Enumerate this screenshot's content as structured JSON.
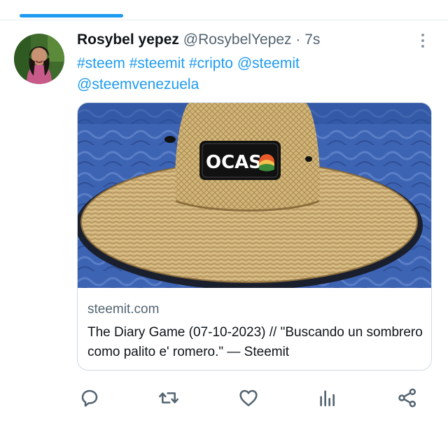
{
  "tweet": {
    "author_name": "Rosybel yepez",
    "handle": "@RosybelYepez",
    "separator": "·",
    "timestamp": "7s",
    "text_line1": "#steem #steemit #cripto @steemit",
    "text_line2": "@steemvenezuela",
    "hashtags": [
      "#steem",
      "#steemit",
      "#cripto"
    ],
    "mentions": [
      "@steemit",
      "@steemvenezuela"
    ]
  },
  "card": {
    "domain": "steemit.com",
    "title": "The Diary Game (07-10-2023) // \"Buscando un sombrero como palito e' romero.\" — Steemit",
    "image_logo_text": "OCASO"
  },
  "actions": [
    "reply-icon",
    "retweet-icon",
    "like-icon",
    "views-icon",
    "share-icon"
  ],
  "colors": {
    "accent": "#1d9bf0",
    "secondary_text": "#536471",
    "icon": "#536471",
    "border": "#cfd9de"
  }
}
